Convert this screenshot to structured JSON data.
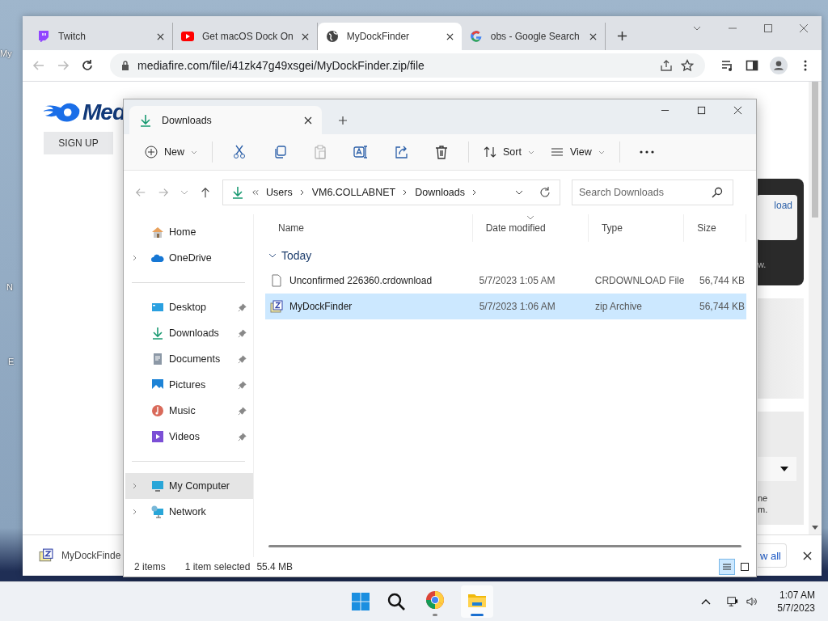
{
  "desktop": {
    "icon_labels": [
      "My",
      "N",
      "E"
    ]
  },
  "browser": {
    "tabs": [
      {
        "title": "Twitch",
        "selected": false
      },
      {
        "title": "Get macOS Dock On",
        "selected": false
      },
      {
        "title": "MyDockFinder",
        "selected": true
      },
      {
        "title": "obs - Google Search",
        "selected": false
      }
    ],
    "url": "mediafire.com/file/i41zk47g49xsgei/MyDockFinder.zip/file",
    "page": {
      "logo": "Med",
      "sign_up": "SIGN UP",
      "download_button": "load",
      "panel_note": "w.",
      "note_lines": [
        "ne",
        "m."
      ]
    },
    "download_bar": {
      "file": "MyDockFinde",
      "show_all": "w all"
    }
  },
  "explorer": {
    "tabs": [
      {
        "title": "Downloads",
        "selected": true
      }
    ],
    "toolbar": {
      "new": "New",
      "actions": [
        {
          "disabled": false
        },
        {
          "disabled": false
        },
        {
          "disabled": true
        },
        {
          "disabled": false
        },
        {
          "disabled": false
        },
        {
          "disabled": false
        }
      ],
      "sort": "Sort",
      "view": "View"
    },
    "breadcrumb": [
      "Users",
      "VM6.COLLABNET",
      "Downloads"
    ],
    "search": {
      "placeholder": "Search Downloads"
    },
    "nav": [
      [
        {
          "label": "Home",
          "selected": false
        },
        {
          "label": "OneDrive",
          "expanded": false,
          "selected": false
        }
      ],
      [
        {
          "label": "Desktop",
          "pinned": true,
          "selected": false
        },
        {
          "label": "Downloads",
          "pinned": true,
          "selected": false
        },
        {
          "label": "Documents",
          "pinned": true,
          "selected": false
        },
        {
          "label": "Pictures",
          "pinned": true,
          "selected": false
        },
        {
          "label": "Music",
          "pinned": true,
          "selected": false
        },
        {
          "label": "Videos",
          "pinned": true,
          "selected": false
        }
      ],
      [
        {
          "label": "My Computer",
          "expanded": false,
          "selected": true
        },
        {
          "label": "Network",
          "expanded": false,
          "selected": false
        }
      ]
    ],
    "columns": [
      "Name",
      "Date modified",
      "Type",
      "Size"
    ],
    "groups": [
      {
        "label": "Today",
        "expanded": true,
        "files": [
          {
            "name": "Unconfirmed 226360.crdownload",
            "kind": "file",
            "date": "5/7/2023 1:05 AM",
            "type": "CRDOWNLOAD File",
            "size": "56,744 KB",
            "selected": false
          },
          {
            "name": "MyDockFinder",
            "kind": "zip",
            "date": "5/7/2023 1:06 AM",
            "type": "zip Archive",
            "size": "56,744 KB",
            "selected": true
          }
        ]
      }
    ],
    "status": {
      "count": "2 items",
      "selection": "1 item selected",
      "size": "55.4 MB"
    },
    "views": [
      {
        "selected": true
      },
      {
        "selected": false
      }
    ]
  },
  "taskbar": {
    "apps": [
      {
        "running": true,
        "selected": false
      },
      {
        "running": true,
        "selected": true
      }
    ],
    "time": "1:07 AM",
    "date": "5/7/2023"
  }
}
